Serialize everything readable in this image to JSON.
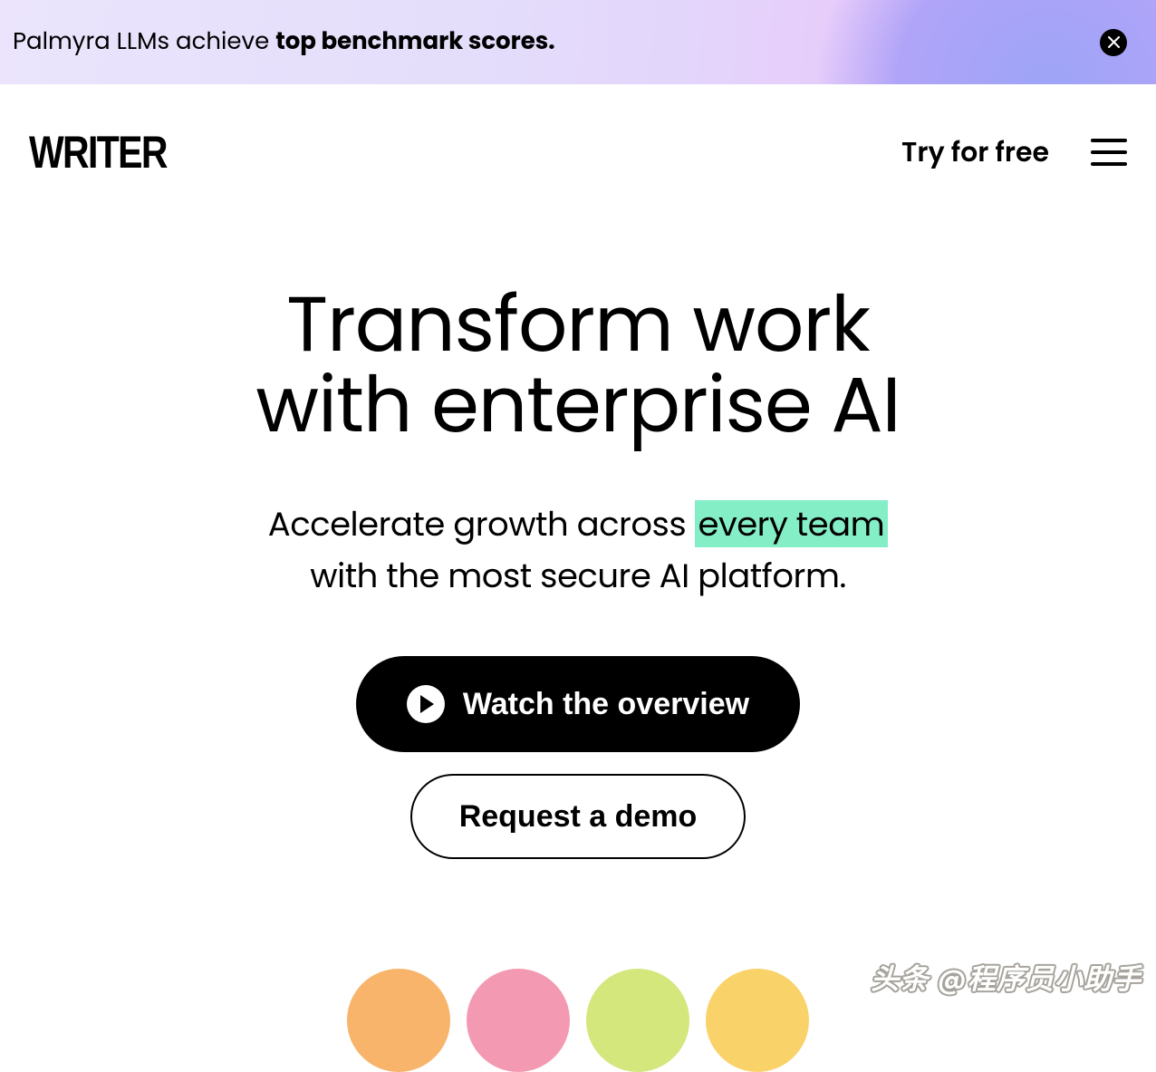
{
  "banner": {
    "text_pre": "Palmyra LLMs achieve ",
    "text_bold": "top benchmark scores."
  },
  "nav": {
    "logo": "WRITER",
    "try_free": "Try for free"
  },
  "hero": {
    "headline_l1": "Transform work",
    "headline_l2": "with enterprise AI",
    "sub_pre": "Accelerate growth across ",
    "sub_highlight": "every team",
    "sub_l2": "with the most secure AI platform.",
    "watch_btn": "Watch the overview",
    "demo_btn": "Request a demo"
  },
  "bubbles": [
    {
      "color": "#f8b46b"
    },
    {
      "color": "#f39ab2"
    },
    {
      "color": "#d3e77d"
    },
    {
      "color": "#f9d36a"
    }
  ],
  "colors": {
    "highlight_bg": "#84eec7"
  },
  "watermark": "头条 @程序员小助手"
}
